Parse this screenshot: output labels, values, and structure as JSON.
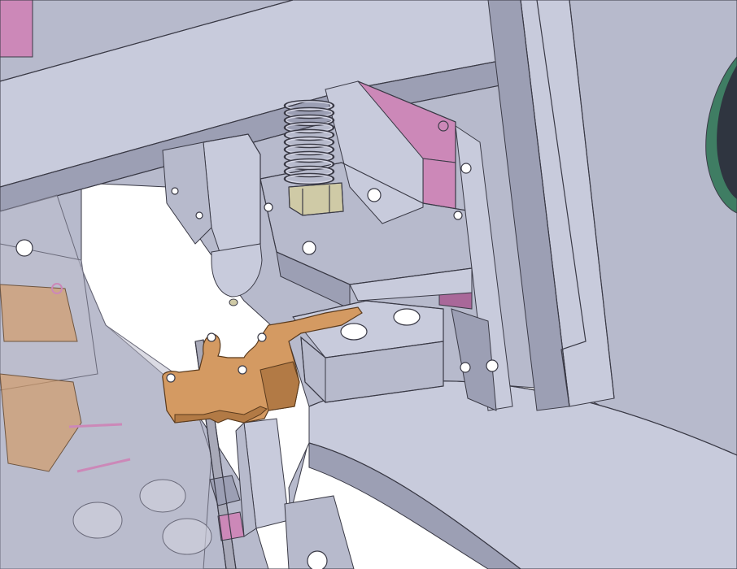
{
  "scene": {
    "kind": "cad-assembly-render",
    "colors": {
      "background": "#ffffff",
      "steel_face": "#b7bacc",
      "steel_light": "#c8cbdc",
      "steel_dark": "#9c9fb4",
      "edge": "#3a3a46",
      "spring": "#d6d7e6",
      "nut": "#cfcaa6",
      "pink_part": "#cc88b8",
      "pink_dark": "#a96899",
      "bronze": "#d49a62",
      "bronze_dark": "#b27a45",
      "rod": "#a8a9b8",
      "green_edge": "#3f7d63",
      "ghost": "rgba(190,190,205,0.55)"
    },
    "components": [
      "top-crossbeam",
      "vertical-column",
      "main-mount-plate",
      "compression-spring",
      "hex-nut",
      "tapered-plunger",
      "pink-bracket",
      "clamp-block",
      "bronze-gripper",
      "push-rod",
      "lower-base-plate",
      "translucent-left-assembly",
      "green-disc"
    ]
  }
}
